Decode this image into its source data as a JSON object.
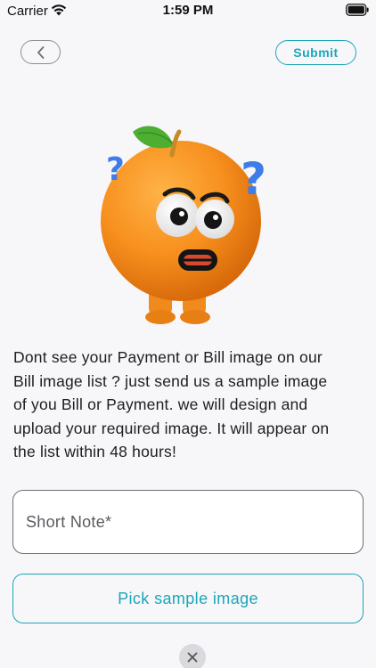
{
  "status_bar": {
    "carrier": "Carrier",
    "time": "1:59 PM",
    "icons": [
      "wifi-icon",
      "battery-icon"
    ]
  },
  "nav": {
    "back_icon": "chevron-left-icon",
    "submit_label": "Submit"
  },
  "illustration": {
    "name": "confused-orange-mascot",
    "marks": [
      "?",
      "?"
    ]
  },
  "message": {
    "lines": [
      "Dont see your Payment or Bill image on our",
      "Bill image list ?  just send us a sample image",
      "of you Bill or Payment. we will design and",
      "upload your required image. It will appear on",
      "the list within 48 hours!"
    ]
  },
  "form": {
    "note_placeholder": "Short Note*",
    "note_value": "",
    "pick_label": "Pick sample image"
  },
  "footer": {
    "close_icon": "close-icon"
  },
  "colors": {
    "accent": "#1ba6b8",
    "background": "#f7f7fa",
    "text": "#1e1e22",
    "border": "#6e6e73"
  }
}
